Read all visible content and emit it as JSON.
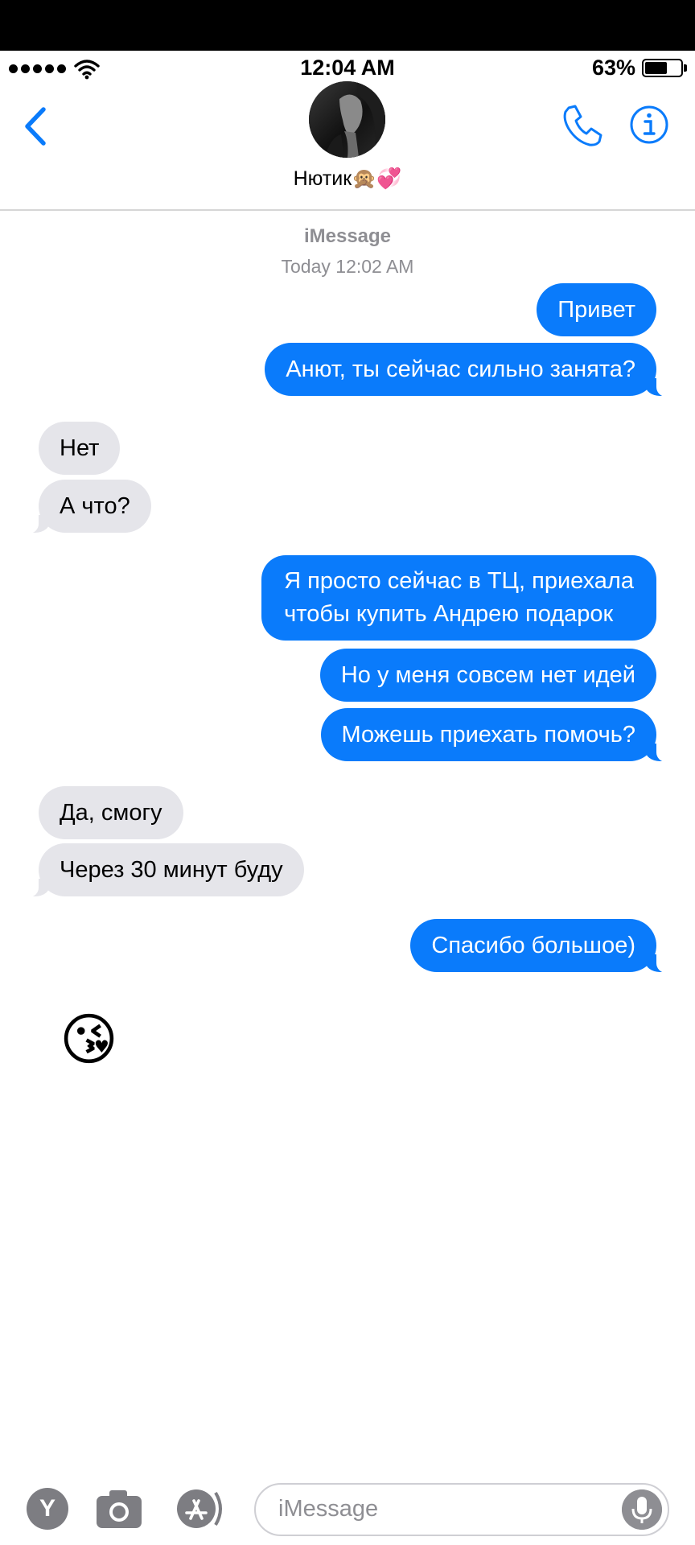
{
  "status": {
    "time": "12:04 AM",
    "battery_pct": "63%",
    "battery_level": 0.63
  },
  "header": {
    "contact_name": "Нютик🙊💞",
    "back_icon": "chevron-left-icon",
    "call_icon": "phone-icon",
    "info_icon": "info-icon"
  },
  "thread": {
    "service": "iMessage",
    "timestamp_label": "Today",
    "timestamp_time": "12:02 AM",
    "messages": [
      {
        "dir": "out",
        "text": "Привет"
      },
      {
        "dir": "out",
        "text": "Анют, ты сейчас сильно занята?"
      },
      {
        "dir": "in",
        "text": "Нет"
      },
      {
        "dir": "in",
        "text": "А что?"
      },
      {
        "dir": "out",
        "text": "Я просто сейчас в ТЦ, приехала\nчтобы купить Андрею подарок"
      },
      {
        "dir": "out",
        "text": "Но у меня совсем нет идей"
      },
      {
        "dir": "out",
        "text": "Можешь приехать помочь?"
      },
      {
        "dir": "in",
        "text": "Да, смогу"
      },
      {
        "dir": "in",
        "text": "Через 30 минут буду"
      },
      {
        "dir": "out",
        "text": "Спасибо большое)"
      },
      {
        "dir": "in",
        "text": "😘"
      }
    ]
  },
  "composer": {
    "y_label": "Y",
    "placeholder": "iMessage",
    "camera_icon": "camera-icon",
    "appstore_icon": "app-store-icon",
    "mic_icon": "microphone-icon"
  },
  "colors": {
    "outgoing_bubble": "#0a7bfb",
    "incoming_bubble": "#e5e5ea",
    "accent": "#0a7bfb",
    "secondary_text": "#8e8e93"
  }
}
